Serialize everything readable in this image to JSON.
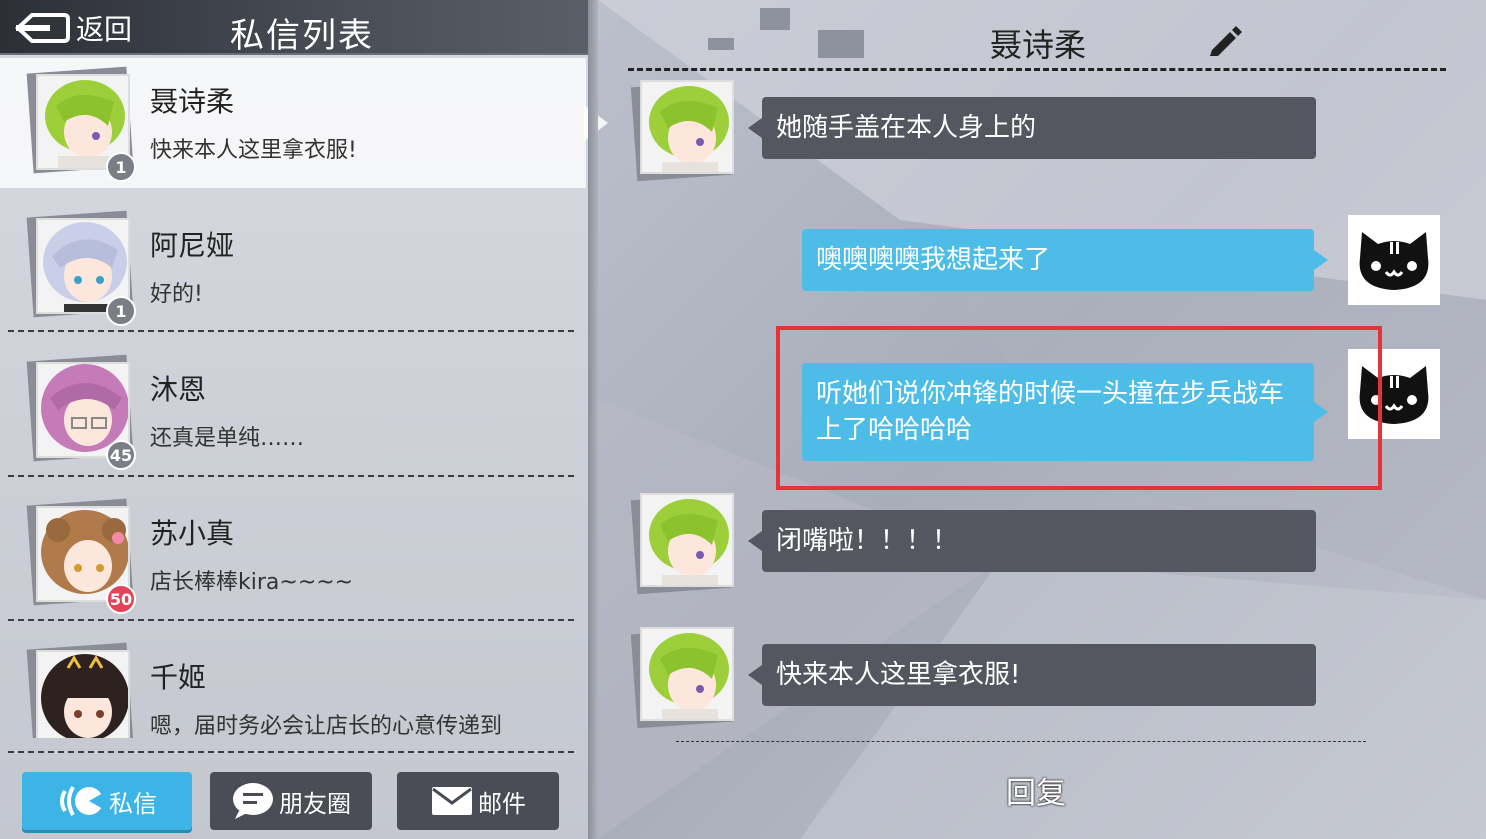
{
  "header": {
    "back_label": "返回",
    "list_title": "私信列表"
  },
  "contacts": [
    {
      "name": "聂诗柔",
      "last_message": "快来本人这里拿衣服!",
      "badge": "1",
      "badge_color": "#7b7e86",
      "hair": "#9ccf3a"
    },
    {
      "name": "阿尼娅",
      "last_message": "好的!",
      "badge": "1",
      "badge_color": "#7b7e86",
      "hair": "#c9cfe8"
    },
    {
      "name": "沐恩",
      "last_message": "还真是单纯……",
      "badge": "45",
      "badge_color": "#7b7e86",
      "hair": "#c47bb8"
    },
    {
      "name": "苏小真",
      "last_message": "店长棒棒kira~~~~",
      "badge": "50",
      "badge_color": "#e2445a",
      "hair": "#b07a4a"
    },
    {
      "name": "千姬",
      "last_message": "嗯，届时务必会让店长的心意传递到",
      "badge": "",
      "badge_color": "#e2445a",
      "hair": "#2d2220"
    }
  ],
  "tabs": {
    "messages": "私信",
    "friends": "朋友圈",
    "mail": "邮件"
  },
  "chat": {
    "title": "聂诗柔",
    "messages": [
      {
        "side": "left",
        "text": "她随手盖在本人身上的"
      },
      {
        "side": "right",
        "text": "噢噢噢噢我想起来了"
      },
      {
        "side": "right",
        "text": "听她们说你冲锋的时候一头撞在步兵战车上了哈哈哈哈"
      },
      {
        "side": "left",
        "text": "闭嘴啦！！！！"
      },
      {
        "side": "left",
        "text": "快来本人这里拿衣服!"
      }
    ],
    "reply_label": "回复"
  },
  "colors": {
    "accent": "#3cb4e6",
    "bubble_left": "#54575f",
    "bubble_right": "#4dbde8",
    "highlight": "#e53338"
  }
}
